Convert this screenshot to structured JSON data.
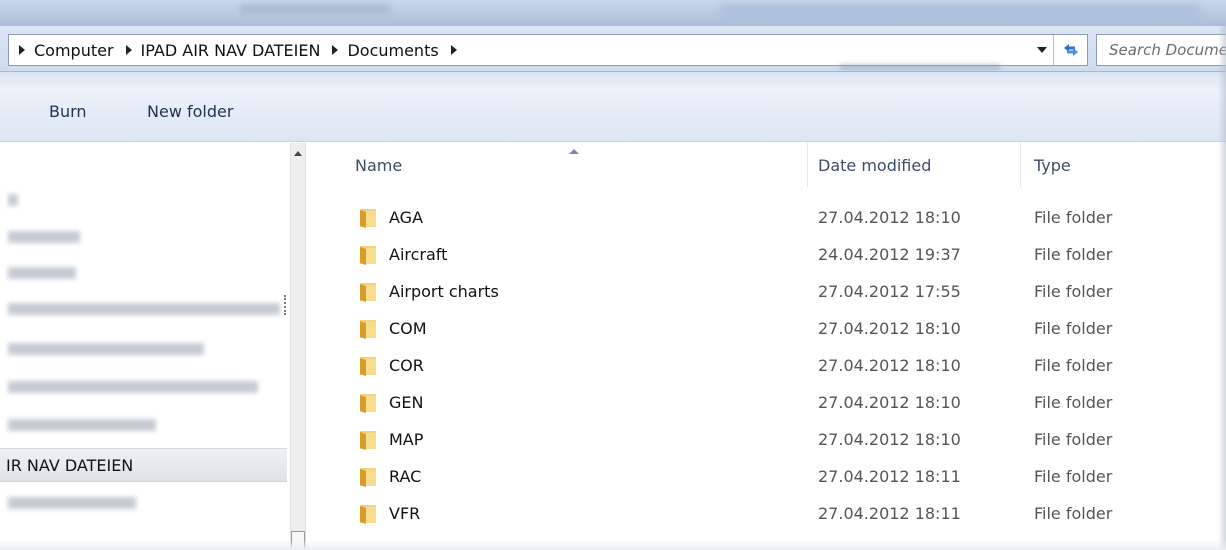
{
  "address": {
    "crumbs": [
      "Computer",
      "IPAD AIR NAV DATEIEN",
      "Documents"
    ],
    "search_placeholder": "Search Documents"
  },
  "toolbar": {
    "burn_label": "Burn",
    "new_folder_label": "New folder"
  },
  "nav": {
    "selected_item": "IR NAV DATEIEN"
  },
  "columns": {
    "name": "Name",
    "date_modified": "Date modified",
    "type": "Type"
  },
  "files": [
    {
      "name": "AGA",
      "date": "27.04.2012 18:10",
      "type": "File folder"
    },
    {
      "name": "Aircraft",
      "date": "24.04.2012 19:37",
      "type": "File folder"
    },
    {
      "name": "Airport charts",
      "date": "27.04.2012 17:55",
      "type": "File folder"
    },
    {
      "name": "COM",
      "date": "27.04.2012 18:10",
      "type": "File folder"
    },
    {
      "name": "COR",
      "date": "27.04.2012 18:10",
      "type": "File folder"
    },
    {
      "name": "GEN",
      "date": "27.04.2012 18:10",
      "type": "File folder"
    },
    {
      "name": "MAP",
      "date": "27.04.2012 18:10",
      "type": "File folder"
    },
    {
      "name": "RAC",
      "date": "27.04.2012 18:11",
      "type": "File folder"
    },
    {
      "name": "VFR",
      "date": "27.04.2012 18:11",
      "type": "File folder"
    }
  ],
  "icons": {
    "folder": "folder-icon",
    "refresh": "refresh-icon"
  },
  "colors": {
    "accent": "#1e3355",
    "folder": "#e8b93b"
  }
}
